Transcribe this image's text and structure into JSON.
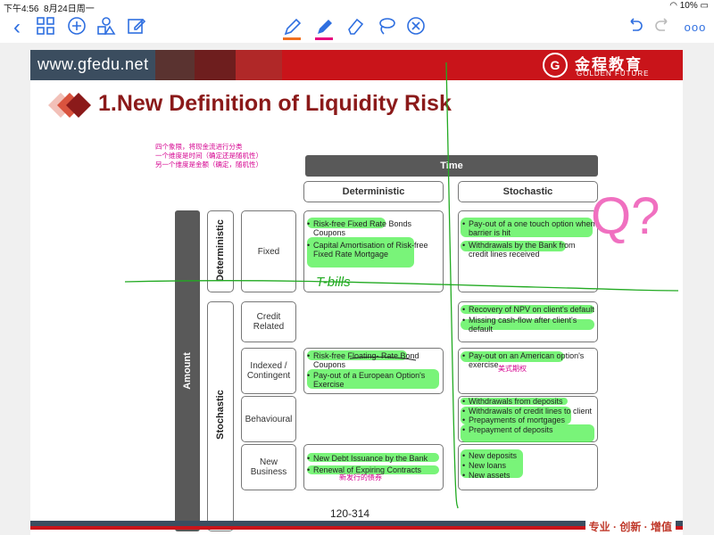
{
  "status": {
    "time": "下午4:56",
    "date": "8月24日周一",
    "battery": "10%"
  },
  "toolbar": {
    "back": "<",
    "grid": "grid-icon",
    "add": "plus-icon",
    "shapes": "shapes-icon",
    "edit": "edit-icon",
    "pen": "pen-icon",
    "highlighter": "highlighter-icon",
    "eraser": "eraser-icon",
    "lasso": "lasso-icon",
    "close": "close-icon",
    "undo": "undo-icon",
    "redo": "redo-icon",
    "more": "ooo",
    "colors": {
      "pen": "#f07020",
      "highlighter": "#e6007e",
      "accent": "#2f6fe0"
    }
  },
  "slide": {
    "website": "www.gfedu.net",
    "logo_cn": "金程教育",
    "logo_en": "GOLDEN FUTURE",
    "title": "1.New Definition of Liquidity Risk",
    "notes": [
      "四个象限，将现金流进行分类",
      "一个维度是时间（确定还是随机性）",
      "另一个维度是金额（确定，随机性）"
    ],
    "time_header": "Time",
    "col_det": "Deterministic",
    "col_sto": "Stochastic",
    "amount": "Amount",
    "row_det": "Deterministic",
    "row_sto": "Stochastic",
    "rows": {
      "fixed": "Fixed",
      "credit": "Credit Related",
      "indexed": "Indexed / Contingent",
      "behav": "Behavioural",
      "newbiz": "New Business"
    },
    "cells": {
      "fixed_det": [
        "Risk-free Fixed Rate Bonds Coupons",
        "Capital Amortisation of Risk-free Fixed Rate Mortgage"
      ],
      "fixed_sto": [
        "Pay-out of a one touch option when barrier is hit",
        "Withdrawals by the Bank from credit lines received"
      ],
      "credit_sto": [
        "Recovery of NPV on client's default",
        "Missing cash-flow after client's default"
      ],
      "indexed_det": [
        "Risk-free Floating- Rate Bond Coupons",
        "Pay-out of a European Option's Exercise"
      ],
      "indexed_sto": [
        "Pay-out on an American option's exercise"
      ],
      "behav_sto": [
        "Withdrawals from deposits",
        "Withdrawals of credit lines to client",
        "Prepayments of mortgages",
        "Prepayment of deposits"
      ],
      "newbiz_det": [
        "New Debt Issuance by the Bank",
        "Renewal of Expiring Contracts"
      ],
      "newbiz_sto": [
        "New deposits",
        "New loans",
        "New assets"
      ]
    },
    "annotations": {
      "tbills": "T-bills",
      "american": "美式期权",
      "newdebt": "新发行的债券",
      "question": "Q?"
    },
    "page_number": "120-314",
    "footer_tag": "专业 · 创新 · 增值"
  }
}
